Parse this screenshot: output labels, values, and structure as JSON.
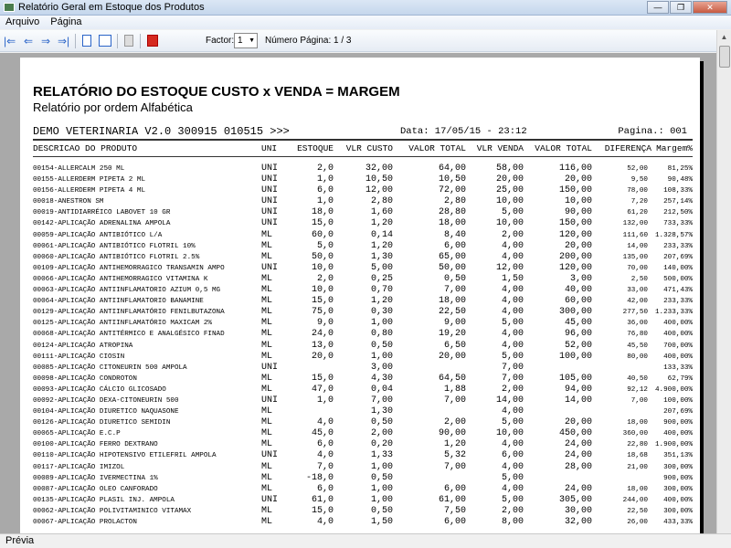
{
  "window": {
    "title": "Relatório Geral em Estoque dos Produtos",
    "minimize": "—",
    "maximize": "❐",
    "close": "✕"
  },
  "menu": [
    "Arquivo",
    "Página"
  ],
  "toolbar": {
    "first": "|⇐",
    "prev": "⇐",
    "next": "⇒",
    "last": "⇒|",
    "factor_label": "Factor:",
    "factor_value": "1",
    "page_info": "Número Página: 1 / 3"
  },
  "report": {
    "title": "RELATÓRIO DO ESTOQUE CUSTO x VENDA = MARGEM",
    "subtitle": "Relatório por ordem Alfabética",
    "company": "DEMO VETERINARIA V2.0 300915 010515 >>>",
    "date": "Data: 17/05/15 - 23:12",
    "page": "Pagina.: 001",
    "columns": [
      "DESCRICAO DO PRODUTO",
      "UNI",
      "ESTOQUE",
      "VLR CUSTO",
      "VALOR TOTAL",
      "VLR VENDA",
      "VALOR TOTAL",
      "DIFERENÇA",
      "Margem%"
    ],
    "rows": [
      [
        "00154-ALLERCALM 250 ML",
        "UNI",
        "2,0",
        "32,00",
        "64,00",
        "58,00",
        "116,00",
        "52,00",
        "81,25%"
      ],
      [
        "00155-ALLERDERM PIPETA 2 ML",
        "UNI",
        "1,0",
        "10,50",
        "10,50",
        "20,00",
        "20,00",
        "9,50",
        "90,48%"
      ],
      [
        "00156-ALLERDERM PIPETA 4 ML",
        "UNI",
        "6,0",
        "12,00",
        "72,00",
        "25,00",
        "150,00",
        "78,00",
        "108,33%"
      ],
      [
        "00018-ANESTRON SM",
        "UNI",
        "1,0",
        "2,80",
        "2,80",
        "10,00",
        "10,00",
        "7,20",
        "257,14%"
      ],
      [
        "00019-ANTIDIARRÉICO LABOVET 10 GR",
        "UNI",
        "18,0",
        "1,60",
        "28,80",
        "5,00",
        "90,00",
        "61,20",
        "212,50%"
      ],
      [
        "00142-APLICAÇÃO ADRENALINA AMPOLA",
        "UNI",
        "15,0",
        "1,20",
        "18,00",
        "10,00",
        "150,00",
        "132,00",
        "733,33%"
      ],
      [
        "00059-APLICAÇÃO ANTIBIÓTICO  L/A",
        "ML",
        "60,0",
        "0,14",
        "8,40",
        "2,00",
        "120,00",
        "111,60",
        "1.328,57%"
      ],
      [
        "00061-APLICAÇÃO ANTIBIÓTICO FLOTRIL 10%",
        "ML",
        "5,0",
        "1,20",
        "6,00",
        "4,00",
        "20,00",
        "14,00",
        "233,33%"
      ],
      [
        "00060-APLICAÇÃO ANTIBIÓTICO FLOTRIL 2.5%",
        "ML",
        "50,0",
        "1,30",
        "65,00",
        "4,00",
        "200,00",
        "135,00",
        "207,69%"
      ],
      [
        "00109-APLICAÇÃO ANTIHEMORRAGICO TRANSAMIN AMPO",
        "UNI",
        "10,0",
        "5,00",
        "50,00",
        "12,00",
        "120,00",
        "70,00",
        "140,00%"
      ],
      [
        "00066-APLICAÇÃO ANTIHEMORRAGICO VITAMINA K",
        "ML",
        "2,0",
        "0,25",
        "0,50",
        "1,50",
        "3,00",
        "2,50",
        "500,00%"
      ],
      [
        "00063-APLICAÇÃO ANTIINFLAMATORIO AZIUM 0,5 MG",
        "ML",
        "10,0",
        "0,70",
        "7,00",
        "4,00",
        "40,00",
        "33,00",
        "471,43%"
      ],
      [
        "00064-APLICAÇÃO ANTIINFLAMATORIO BANAMINE",
        "ML",
        "15,0",
        "1,20",
        "18,00",
        "4,00",
        "60,00",
        "42,00",
        "233,33%"
      ],
      [
        "00129-APLICAÇÃO ANTIINFLAMATÓRIO FENILBUTAZONA",
        "ML",
        "75,0",
        "0,30",
        "22,50",
        "4,00",
        "300,00",
        "277,50",
        "1.233,33%"
      ],
      [
        "00125-APLICAÇÃO ANTIINFLAMATÓRIO MAXICAM 2%",
        "ML",
        "9,0",
        "1,00",
        "9,00",
        "5,00",
        "45,00",
        "36,00",
        "400,00%"
      ],
      [
        "00068-APLICAÇÃO ANTITÉRMICO E ANALGÉSICO FINAD",
        "ML",
        "24,0",
        "0,80",
        "19,20",
        "4,00",
        "96,00",
        "76,80",
        "400,00%"
      ],
      [
        "00124-APLICAÇÃO ATROPINA",
        "ML",
        "13,0",
        "0,50",
        "6,50",
        "4,00",
        "52,00",
        "45,50",
        "700,00%"
      ],
      [
        "00111-APLICAÇÃO CIOSIN",
        "ML",
        "20,0",
        "1,00",
        "20,00",
        "5,00",
        "100,00",
        "80,00",
        "400,00%"
      ],
      [
        "00085-APLICAÇÃO CITONEURIN 500 AMPOLA",
        "UNI",
        "",
        "3,00",
        "",
        "7,00",
        "",
        "",
        "133,33%"
      ],
      [
        "00098-APLICAÇÃO CONDROTON",
        "ML",
        "15,0",
        "4,30",
        "64,50",
        "7,00",
        "105,00",
        "40,50",
        "62,79%"
      ],
      [
        "00093-APLICAÇÃO CÁLCIO GLICOSADO",
        "ML",
        "47,0",
        "0,04",
        "1,88",
        "2,00",
        "94,00",
        "92,12",
        "4.900,00%"
      ],
      [
        "00092-APLICAÇÃO DEXA-CITONEURIN 500",
        "UNI",
        "1,0",
        "7,00",
        "7,00",
        "14,00",
        "14,00",
        "7,00",
        "100,00%"
      ],
      [
        "00104-APLICAÇÃO DIURETICO NAQUASONE",
        "ML",
        "",
        "1,30",
        "",
        "4,00",
        "",
        "",
        "207,69%"
      ],
      [
        "00126-APLICAÇÃO DIURETICO SEMIDIN",
        "ML",
        "4,0",
        "0,50",
        "2,00",
        "5,00",
        "20,00",
        "18,00",
        "900,00%"
      ],
      [
        "00065-APLICAÇÃO E.C.P",
        "ML",
        "45,0",
        "2,00",
        "90,00",
        "10,00",
        "450,00",
        "360,00",
        "400,00%"
      ],
      [
        "00100-APLICAÇÃO FERRO DEXTRANO",
        "ML",
        "6,0",
        "0,20",
        "1,20",
        "4,00",
        "24,00",
        "22,80",
        "1.900,00%"
      ],
      [
        "00110-APLICAÇÃO HIPOTENSIVO ETILEFRIL AMPOLA",
        "UNI",
        "4,0",
        "1,33",
        "5,32",
        "6,00",
        "24,00",
        "18,68",
        "351,13%"
      ],
      [
        "00117-APLICAÇÃO IMIZOL",
        "ML",
        "7,0",
        "1,00",
        "7,00",
        "4,00",
        "28,00",
        "21,00",
        "300,00%"
      ],
      [
        "00089-APLICAÇÃO IVERMECTINA 1%",
        "ML",
        "-18,0",
        "0,50",
        "",
        "5,00",
        "",
        "",
        "900,00%"
      ],
      [
        "00087-APLICAÇÃO OLEO CANFORADO",
        "ML",
        "6,0",
        "1,00",
        "6,00",
        "4,00",
        "24,00",
        "18,00",
        "300,00%"
      ],
      [
        "00135-APLICAÇÃO PLASIL INJ. AMPOLA",
        "UNI",
        "61,0",
        "1,00",
        "61,00",
        "5,00",
        "305,00",
        "244,00",
        "400,00%"
      ],
      [
        "00062-APLICAÇÃO POLIVITAMINICO VITAMAX",
        "ML",
        "15,0",
        "0,50",
        "7,50",
        "2,00",
        "30,00",
        "22,50",
        "300,00%"
      ],
      [
        "00067-APLICAÇÃO PROLACTON",
        "ML",
        "4,0",
        "1,50",
        "6,00",
        "8,00",
        "32,00",
        "26,00",
        "433,33%"
      ]
    ]
  },
  "status": "Prévia"
}
